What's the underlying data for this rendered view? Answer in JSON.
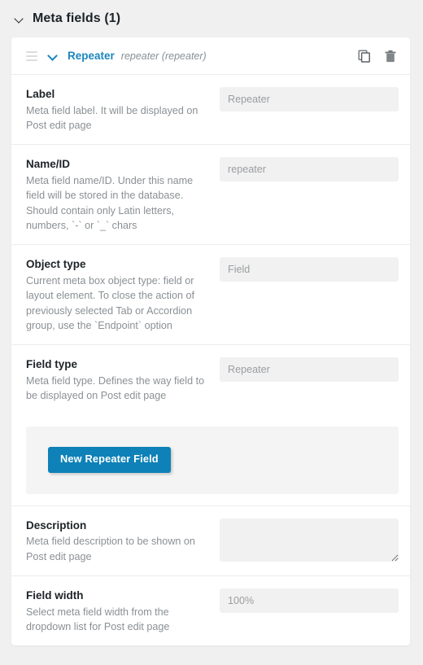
{
  "page": {
    "title": "Meta fields (1)",
    "collapse_icon": "chevron-down-icon"
  },
  "colors": {
    "accent": "#1a86bd",
    "button": "#0e81b8",
    "page_background": "#f0f0f1",
    "card_background": "#ffffff",
    "input_background": "#f1f1f1",
    "divider": "#ececec",
    "label_text": "#1d2327",
    "muted_text": "#8b9094"
  },
  "item": {
    "drag_handle_icon": "drag-handle-icon",
    "toggle_icon": "chevron-down-icon",
    "name": "Repeater",
    "slug": "repeater (repeater)",
    "duplicate_icon": "copy-icon",
    "delete_icon": "trash-icon"
  },
  "fields": [
    {
      "label": "Label",
      "description": "Meta field label. It will be displayed on Post edit page",
      "control": "input",
      "value": "Repeater",
      "name": "label-field"
    },
    {
      "label": "Name/ID",
      "description": "Meta field name/ID. Under this name field will be stored in the database. Should contain only Latin letters, numbers, `-` or `_` chars",
      "control": "input",
      "value": "repeater",
      "name": "name-id-field"
    },
    {
      "label": "Object type",
      "description": "Current meta box object type: field or layout element. To close the action of previously selected Tab or Accordion group, use the `Endpoint` option",
      "control": "input",
      "value": "Field",
      "name": "object-type-field"
    },
    {
      "label": "Field type",
      "description": "Meta field type. Defines the way field to be displayed on Post edit page",
      "control": "input",
      "value": "Repeater",
      "name": "field-type-field"
    }
  ],
  "builder": {
    "button_label": "New Repeater Field"
  },
  "fields_after": [
    {
      "label": "Description",
      "description": "Meta field description to be shown on Post edit page",
      "control": "textarea",
      "value": "",
      "placeholder": "",
      "name": "description-field"
    },
    {
      "label": "Field width",
      "description": "Select meta field width from the dropdown list for Post edit page",
      "control": "input",
      "value": "100%",
      "name": "field-width-field"
    }
  ]
}
